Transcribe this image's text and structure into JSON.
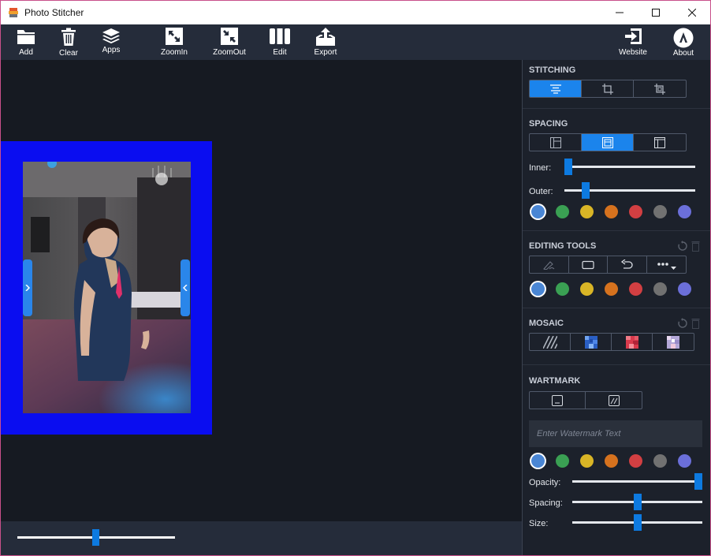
{
  "window": {
    "title": "Photo Stitcher"
  },
  "toolbar": {
    "add": "Add",
    "clear": "Clear",
    "apps": "Apps",
    "zoomin": "ZoomIn",
    "zoomout": "ZoomOut",
    "edit": "Edit",
    "export": "Export",
    "website": "Website",
    "about": "About"
  },
  "zoom": {
    "level": 0.5
  },
  "panel": {
    "stitching": {
      "title": "STITCHING",
      "selected_index": 0
    },
    "spacing": {
      "title": "SPACING",
      "selected_index": 1,
      "inner_label": "Inner:",
      "inner_value": 0.0,
      "outer_label": "Outer:",
      "outer_value": 0.16
    },
    "editing": {
      "title": "EDITING TOOLS"
    },
    "mosaic": {
      "title": "MOSAIC"
    },
    "watermark": {
      "title": "WARTMARK",
      "placeholder": "Enter Watermark Text",
      "opacity_label": "Opacity:",
      "opacity_value": 1.0,
      "spacing_label": "Spacing:",
      "spacing_value": 0.5,
      "size_label": "Size:",
      "size_value": 0.5
    },
    "palette": [
      "#4a86d4",
      "#3aa053",
      "#d9b526",
      "#d6721e",
      "#d23f42",
      "#717171",
      "#6b6fd9"
    ]
  },
  "icons": {
    "app": "photo-stitcher-logo",
    "add": "folder-icon",
    "clear": "trash-icon",
    "apps": "layers-icon",
    "zoomin": "expand-icon",
    "zoomout": "compress-icon",
    "edit": "columns-icon",
    "export": "export-tray-icon",
    "website": "login-arrow-icon",
    "about": "letter-a-circle-icon"
  },
  "colors": {
    "accent": "#1b84ec",
    "frame": "#0a0df0",
    "panel": "#1c212b",
    "toolbar": "#252c3a"
  }
}
